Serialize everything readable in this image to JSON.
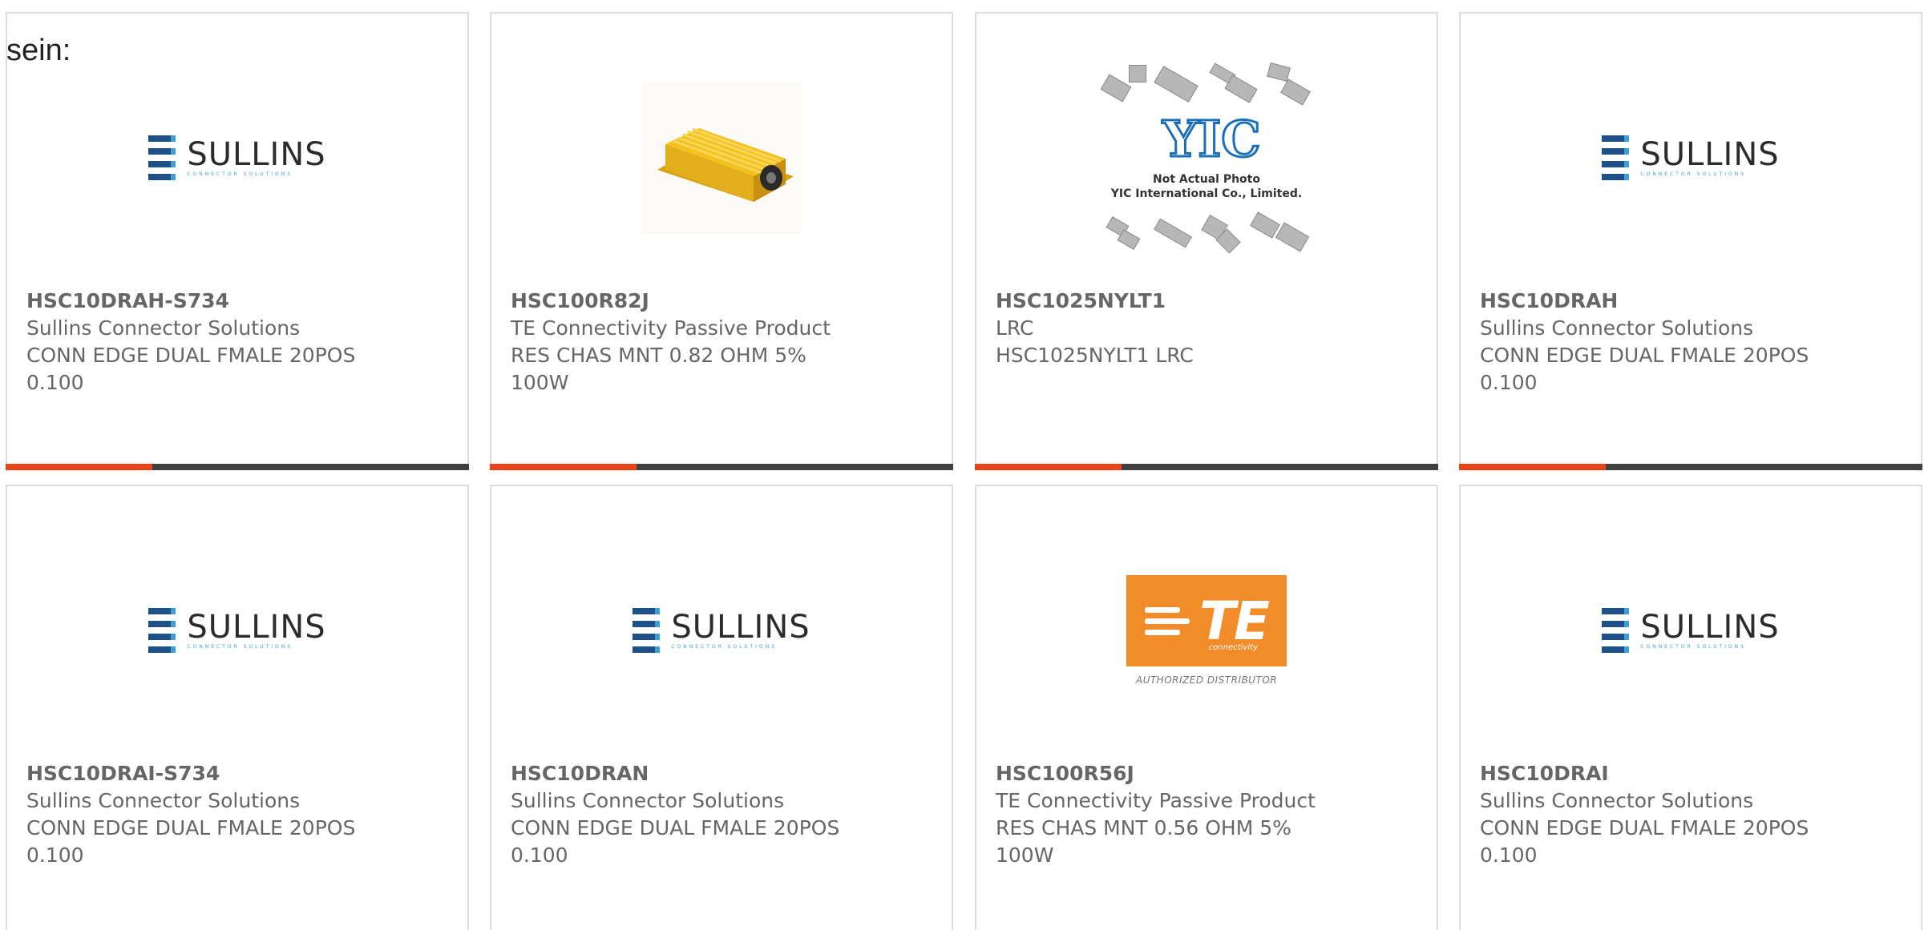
{
  "heading": "sein:",
  "colors": {
    "accent": "#e8431a",
    "bar_dark": "#404040",
    "text": "#666666",
    "border": "#dcdcdc"
  },
  "products": [
    {
      "part_number": "HSC10DRAH-S734",
      "manufacturer": "Sullins Connector Solutions",
      "description_line1": "CONN EDGE DUAL FMALE 20POS",
      "description_line2": "0.100",
      "image": "sullins-logo"
    },
    {
      "part_number": "HSC100R82J",
      "manufacturer": "TE Connectivity Passive Product",
      "description_line1": "RES CHAS MNT 0.82 OHM 5%",
      "description_line2": "100W",
      "image": "resistor-photo"
    },
    {
      "part_number": "HSC1025NYLT1",
      "manufacturer": "LRC",
      "description_line1": "HSC1025NYLT1 LRC",
      "description_line2": "",
      "image": "yic-placeholder"
    },
    {
      "part_number": "HSC10DRAH",
      "manufacturer": "Sullins Connector Solutions",
      "description_line1": "CONN EDGE DUAL FMALE 20POS",
      "description_line2": "0.100",
      "image": "sullins-logo"
    },
    {
      "part_number": "HSC10DRAI-S734",
      "manufacturer": "Sullins Connector Solutions",
      "description_line1": "CONN EDGE DUAL FMALE 20POS",
      "description_line2": "0.100",
      "image": "sullins-logo"
    },
    {
      "part_number": "HSC10DRAN",
      "manufacturer": "Sullins Connector Solutions",
      "description_line1": "CONN EDGE DUAL FMALE 20POS",
      "description_line2": "0.100",
      "image": "sullins-logo"
    },
    {
      "part_number": "HSC100R56J",
      "manufacturer": "TE Connectivity Passive Product",
      "description_line1": "RES CHAS MNT 0.56 OHM 5%",
      "description_line2": "100W",
      "image": "te-logo"
    },
    {
      "part_number": "HSC10DRAI",
      "manufacturer": "Sullins Connector Solutions",
      "description_line1": "CONN EDGE DUAL FMALE 20POS",
      "description_line2": "0.100",
      "image": "sullins-logo"
    }
  ],
  "logos": {
    "sullins_name": "SULLINS",
    "sullins_sub": "CONNECTOR SOLUTIONS",
    "yic_mark": "YIC",
    "yic_note_line1": "Not Actual Photo",
    "yic_note_line2": "YIC International Co., Limited.",
    "te_mark": "TE",
    "te_sub": "connectivity",
    "te_authorized": "AUTHORIZED DISTRIBUTOR"
  }
}
